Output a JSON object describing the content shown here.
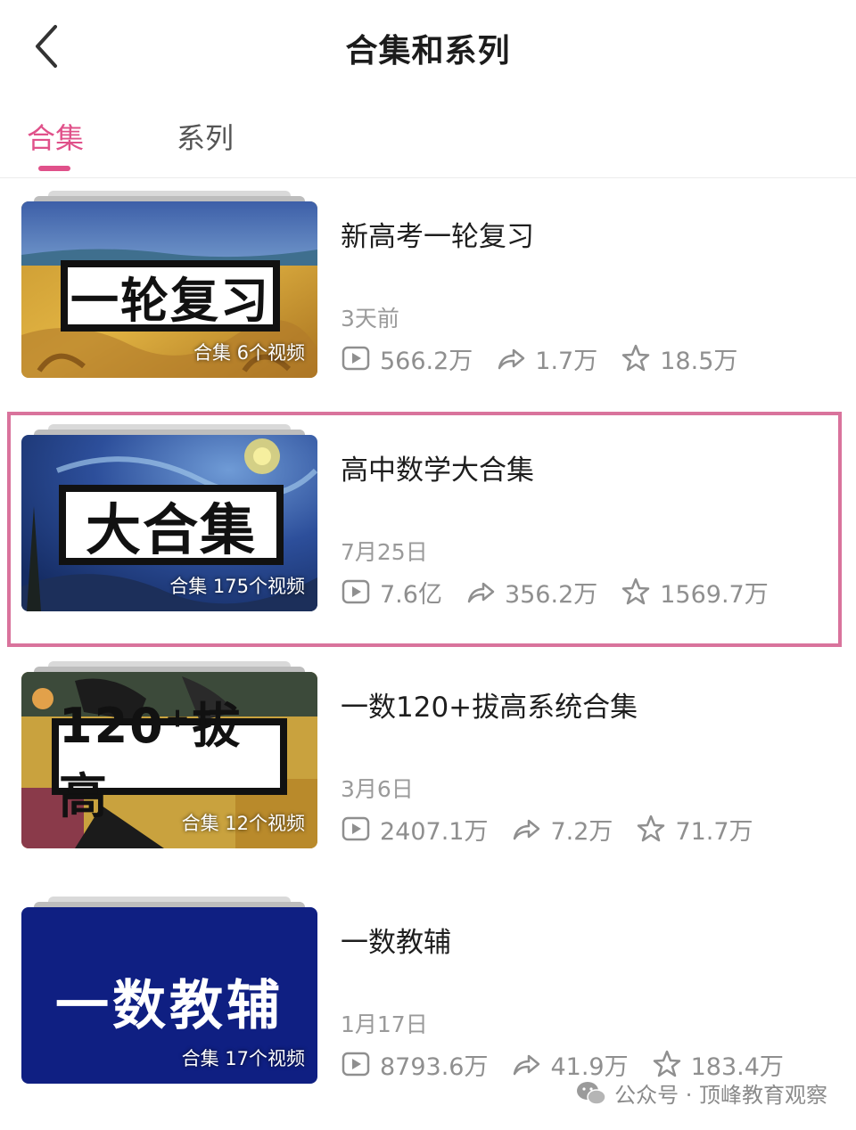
{
  "header": {
    "title": "合集和系列",
    "back_icon": "chevron-left-icon"
  },
  "tabs": [
    {
      "label": "合集",
      "active": true
    },
    {
      "label": "系列",
      "active": false
    }
  ],
  "colors": {
    "accent": "#e0518a",
    "highlight_border": "#d9739c",
    "meta_gray": "#8f8f8f"
  },
  "items": [
    {
      "thumb_label": "一轮复习",
      "thumb_count": "合集 6个视频",
      "title": "新高考一轮复习",
      "date": "3天前",
      "plays": "566.2万",
      "shares": "1.7万",
      "favorites": "18.5万"
    },
    {
      "thumb_label": "大合集",
      "thumb_count": "合集 175个视频",
      "title": "高中数学大合集",
      "date": "7月25日",
      "plays": "7.6亿",
      "shares": "356.2万",
      "favorites": "1569.7万"
    },
    {
      "thumb_label": "120⁺拔高",
      "thumb_count": "合集 12个视频",
      "title": "一数120+拔高系统合集",
      "date": "3月6日",
      "plays": "2407.1万",
      "shares": "7.2万",
      "favorites": "71.7万"
    },
    {
      "thumb_label": "一数教辅",
      "thumb_count": "合集 17个视频",
      "title": "一数教辅",
      "date": "1月17日",
      "plays": "8793.6万",
      "shares": "41.9万",
      "favorites": "183.4万"
    }
  ],
  "watermark": {
    "text": "公众号 · 顶峰教育观察",
    "icon": "wechat-icon"
  }
}
